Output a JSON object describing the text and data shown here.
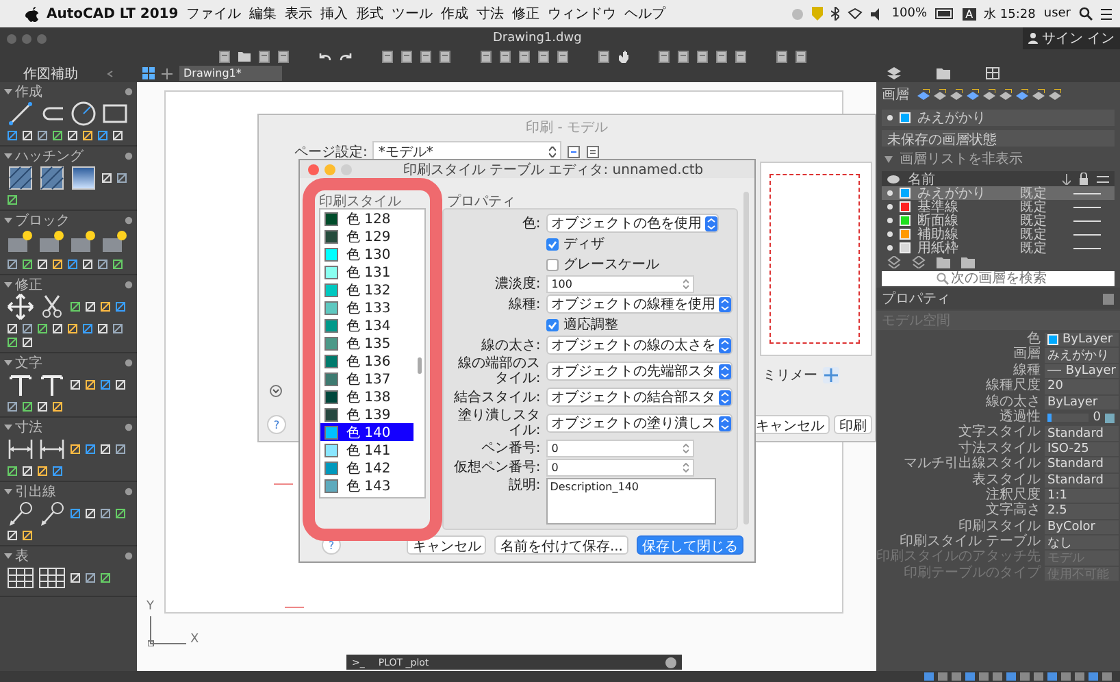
{
  "menubar": {
    "app": "AutoCAD LT 2019",
    "items": [
      "ファイル",
      "編集",
      "表示",
      "挿入",
      "形式",
      "ツール",
      "作成",
      "寸法",
      "修正",
      "ウィンドウ",
      "ヘルプ"
    ],
    "battery": "100%",
    "input": "A",
    "clock": "水 15:28",
    "user": "user"
  },
  "titlebar": {
    "title": "Drawing1.dwg",
    "sign_in": "サイン イン"
  },
  "palette": {
    "title": "作図補助",
    "sections": [
      {
        "title": "作成",
        "expanded": true
      },
      {
        "title": "ハッチング",
        "expanded": true
      },
      {
        "title": "ブロック",
        "expanded": true
      },
      {
        "title": "修正",
        "expanded": true
      },
      {
        "title": "文字",
        "expanded": true
      },
      {
        "title": "寸法",
        "expanded": true
      },
      {
        "title": "引出線",
        "expanded": true
      },
      {
        "title": "表",
        "expanded": true
      }
    ]
  },
  "tabs": [
    {
      "label": "Drawing1*",
      "selected": true
    }
  ],
  "plot_dialog": {
    "title": "印刷 - モデル",
    "page_setup_label": "ページ設定:",
    "page_setup_value": "*モデル*",
    "unit": "ミリメー",
    "help": "?",
    "buttons": [
      {
        "label": "キャンセル",
        "primary": false
      },
      {
        "label": "印刷",
        "primary": false
      }
    ]
  },
  "editor": {
    "title": "印刷スタイル テーブル エディタ: unnamed.ctb",
    "list_title": "印刷スタイル",
    "props_title": "プロパティ",
    "help": "?",
    "styles": [
      {
        "label": "色 128",
        "color": "#004c2a",
        "selected": false
      },
      {
        "label": "色 129",
        "color": "#264c3d",
        "selected": false
      },
      {
        "label": "色 130",
        "color": "#00ffff",
        "selected": false
      },
      {
        "label": "色 131",
        "color": "#8afff0",
        "selected": false
      },
      {
        "label": "色 132",
        "color": "#00c8c0",
        "selected": false
      },
      {
        "label": "色 133",
        "color": "#5ec8c0",
        "selected": false
      },
      {
        "label": "色 134",
        "color": "#00998a",
        "selected": false
      },
      {
        "label": "色 135",
        "color": "#4c9988",
        "selected": false
      },
      {
        "label": "色 136",
        "color": "#007a6c",
        "selected": false
      },
      {
        "label": "色 137",
        "color": "#3d7a70",
        "selected": false
      },
      {
        "label": "色 138",
        "color": "#00473c",
        "selected": false
      },
      {
        "label": "色 139",
        "color": "#25473f",
        "selected": false
      },
      {
        "label": "色 140",
        "color": "#00c0ff",
        "selected": true
      },
      {
        "label": "色 141",
        "color": "#8ae6ff",
        "selected": false
      },
      {
        "label": "色 142",
        "color": "#0099bd",
        "selected": false
      },
      {
        "label": "色 143",
        "color": "#5eaabd",
        "selected": false
      }
    ],
    "props": [
      {
        "kind": "dropdown",
        "label": "色:",
        "value": "オブジェクトの色を使用"
      },
      {
        "kind": "checkbox",
        "label": "ディザ",
        "checked": true
      },
      {
        "kind": "checkbox",
        "label": "グレースケール",
        "checked": false
      },
      {
        "kind": "spinner",
        "label": "濃淡度:",
        "value": "100"
      },
      {
        "kind": "dropdown",
        "label": "線種:",
        "value": "オブジェクトの線種を使用"
      },
      {
        "kind": "checkbox",
        "label": "適応調整",
        "checked": true
      },
      {
        "kind": "dropdown",
        "label": "線の太さ:",
        "value": "オブジェクトの線の太さを"
      },
      {
        "kind": "dropdown",
        "label": "線の端部のスタイル:",
        "value": "オブジェクトの先端部スタ"
      },
      {
        "kind": "dropdown",
        "label": "結合スタイル:",
        "value": "オブジェクトの結合部スタ"
      },
      {
        "kind": "dropdown",
        "label": "塗り潰しスタイル:",
        "value": "オブジェクトの塗り潰しス"
      },
      {
        "kind": "spinner",
        "label": "ペン番号:",
        "value": "0"
      },
      {
        "kind": "spinner",
        "label": "仮想ペン番号:",
        "value": "0"
      },
      {
        "kind": "textarea",
        "label": "説明:",
        "value": "Description_140"
      }
    ],
    "buttons": [
      {
        "label": "キャンセル",
        "primary": false
      },
      {
        "label": "名前を付けて保存...",
        "primary": false
      },
      {
        "label": "保存して閉じる",
        "primary": true
      }
    ]
  },
  "layers_panel": {
    "title": "画層",
    "current": {
      "name": "みえがかり",
      "color": "#00aaff"
    },
    "state": "未保存の画層状態",
    "toggle": "画層リストを非表示",
    "name_column": "名前",
    "layers": [
      {
        "name": "みえがかり",
        "color": "#00aaff",
        "default": "既定",
        "selected": true
      },
      {
        "name": "基準線",
        "color": "#ff2020",
        "default": "既定",
        "selected": false
      },
      {
        "name": "断面線",
        "color": "#20e020",
        "default": "既定",
        "selected": false
      },
      {
        "name": "補助線",
        "color": "#ff9900",
        "default": "既定",
        "selected": false
      },
      {
        "name": "用紙枠",
        "color": "#d8d8d8",
        "default": "既定",
        "selected": false
      }
    ],
    "search": {
      "placeholder": "次の画層を検索"
    }
  },
  "properties": {
    "title": "プロパティ",
    "context": "モデル空間",
    "rows": [
      {
        "kind": "swatch",
        "label": "色",
        "value": "ByLayer",
        "color": "#00aaff",
        "disabled": false
      },
      {
        "kind": "text",
        "label": "画層",
        "value": "みえがかり",
        "disabled": false
      },
      {
        "kind": "linetype",
        "label": "線種",
        "value": "ByLayer",
        "disabled": false
      },
      {
        "kind": "text",
        "label": "線種尺度",
        "value": "20",
        "disabled": false
      },
      {
        "kind": "text",
        "label": "線の太さ",
        "value": "ByLayer",
        "disabled": false
      },
      {
        "kind": "slider",
        "label": "透過性",
        "value": "0",
        "level": 0,
        "disabled": false
      },
      {
        "kind": "text",
        "label": "文字スタイル",
        "value": "Standard",
        "disabled": false
      },
      {
        "kind": "text",
        "label": "寸法スタイル",
        "value": "ISO-25",
        "disabled": false
      },
      {
        "kind": "text",
        "label": "マルチ引出線スタイル",
        "value": "Standard",
        "disabled": false
      },
      {
        "kind": "text",
        "label": "表スタイル",
        "value": "Standard",
        "disabled": false
      },
      {
        "kind": "text",
        "label": "注釈尺度",
        "value": "1:1",
        "disabled": false
      },
      {
        "kind": "text",
        "label": "文字高さ",
        "value": "2.5",
        "disabled": false
      },
      {
        "kind": "text",
        "label": "印刷スタイル",
        "value": "ByColor",
        "disabled": false
      },
      {
        "kind": "text",
        "label": "印刷スタイル テーブル",
        "value": "なし",
        "disabled": false
      },
      {
        "kind": "text",
        "label": "印刷スタイルのアタッチ先",
        "value": "モデル",
        "disabled": true
      },
      {
        "kind": "text",
        "label": "印刷テーブルのタイプ",
        "value": "使用不可能",
        "disabled": true
      }
    ]
  },
  "command_line": {
    "prompt": ">_",
    "text": "PLOT _plot"
  },
  "ucs": {
    "x": "X",
    "y": "Y"
  }
}
